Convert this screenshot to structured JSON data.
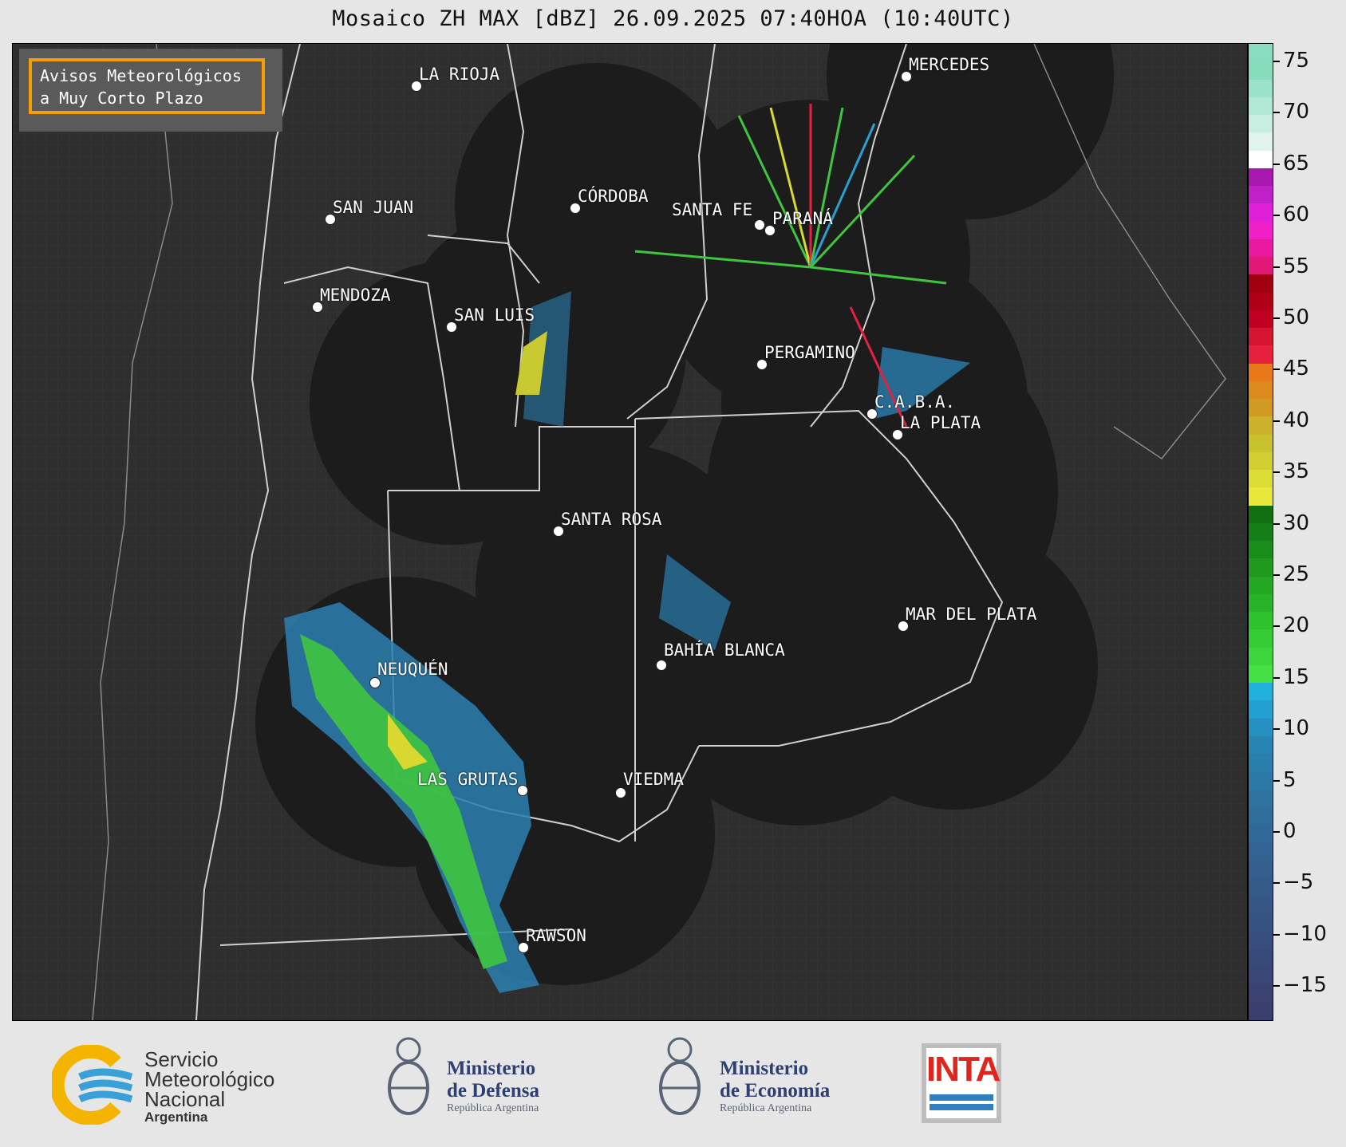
{
  "title": "Mosaico ZH MAX [dBZ] 26.09.2025 07:40HOA (10:40UTC)",
  "notice": {
    "line1": "Avisos Meteorológicos",
    "line2": "a Muy Corto Plazo"
  },
  "cities": [
    {
      "key": "la-rioja",
      "name": "LA RIOJA"
    },
    {
      "key": "mercedes",
      "name": "MERCEDES"
    },
    {
      "key": "cordoba",
      "name": "CÓRDOBA"
    },
    {
      "key": "san-juan",
      "name": "SAN JUAN"
    },
    {
      "key": "santa-fe",
      "name": "SANTA FE"
    },
    {
      "key": "parana",
      "name": "PARANÁ"
    },
    {
      "key": "mendoza",
      "name": "MENDOZA"
    },
    {
      "key": "san-luis",
      "name": "SAN LUIS"
    },
    {
      "key": "pergamino",
      "name": "PERGAMINO"
    },
    {
      "key": "caba",
      "name": "C.A.B.A."
    },
    {
      "key": "la-plata",
      "name": "LA PLATA"
    },
    {
      "key": "santa-rosa",
      "name": "SANTA ROSA"
    },
    {
      "key": "mar-del-plata",
      "name": "MAR DEL PLATA"
    },
    {
      "key": "bahia-blanca",
      "name": "BAHÍA BLANCA"
    },
    {
      "key": "neuquen",
      "name": "NEUQUÉN"
    },
    {
      "key": "las-grutas",
      "name": "LAS GRUTAS"
    },
    {
      "key": "viedma",
      "name": "VIEDMA"
    },
    {
      "key": "rawson",
      "name": "RAWSON"
    }
  ],
  "colorbar": {
    "ticks": [
      "75",
      "70",
      "65",
      "60",
      "55",
      "50",
      "45",
      "40",
      "35",
      "30",
      "25",
      "20",
      "15",
      "10",
      "5",
      "0",
      "−5",
      "−10",
      "−15"
    ],
    "colors": [
      "#3a3f6e",
      "#3a4272",
      "#394676",
      "#384a7a",
      "#374e7e",
      "#365282",
      "#355686",
      "#345a8a",
      "#335e8e",
      "#326392",
      "#306896",
      "#2f6d9b",
      "#2e72a0",
      "#2c78a6",
      "#2a7eac",
      "#2884b2",
      "#2690c0",
      "#23a0cf",
      "#20b0dc",
      "#44e044",
      "#3cd63c",
      "#34cc34",
      "#2ec22e",
      "#28b428",
      "#24a824",
      "#1f9a1f",
      "#1a8c1a",
      "#167e16",
      "#127012",
      "#e8e83a",
      "#dcdc36",
      "#d2cf32",
      "#c8c22e",
      "#cbb22a",
      "#d09a22",
      "#dc8a1e",
      "#e8781a",
      "#e82040",
      "#d41430",
      "#c00020",
      "#b00018",
      "#a00010",
      "#e01878",
      "#e818a0",
      "#f020c8",
      "#e020d8",
      "#c020c8",
      "#a818b0",
      "#ffffff",
      "#e0f4ee",
      "#c8eee2",
      "#b2e8d6",
      "#9ce2ca",
      "#88dcbe",
      "#8adcc0"
    ]
  },
  "footer": {
    "smn": {
      "line1": "Servicio",
      "line2": "Meteorológico",
      "line3": "Nacional",
      "line4": "Argentina"
    },
    "defensa": {
      "line1": "Ministerio",
      "line2": "de Defensa",
      "line3": "República Argentina"
    },
    "economia": {
      "line1": "Ministerio",
      "line2": "de Economía",
      "line3": "República Argentina"
    },
    "inta": {
      "label": "INTA"
    }
  }
}
